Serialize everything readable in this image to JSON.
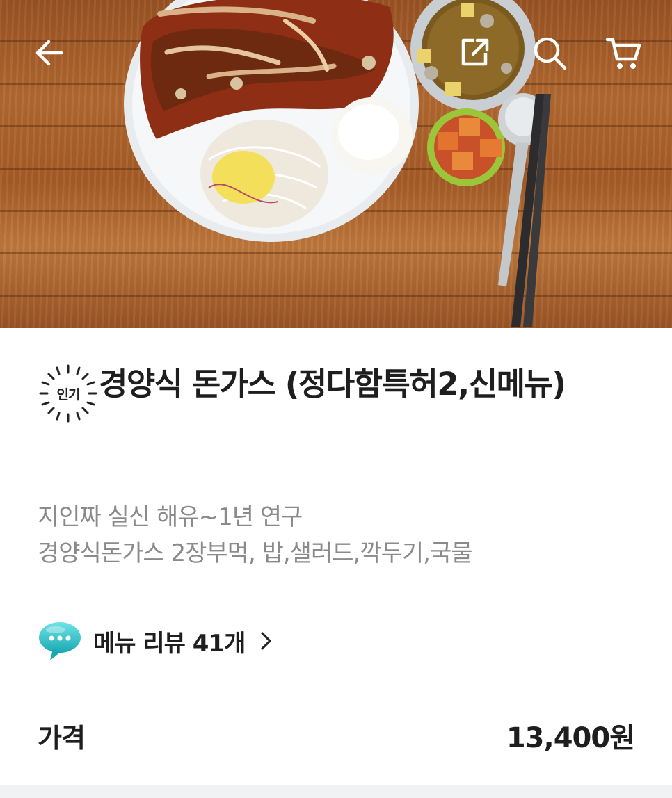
{
  "header": {
    "back_icon": "arrow-left-icon",
    "share_icon": "share-icon",
    "search_icon": "search-icon",
    "cart_icon": "cart-icon",
    "icon_color": "#ffffff"
  },
  "menu": {
    "badge_label": "인기",
    "title": "경양식 돈가스 (정다함특허2,신메뉴)",
    "description_lines": [
      "지인짜 실신 해유~1년 연구",
      "경양식돈가스 2장부먹, 밥,샐러드,깍두기,국물"
    ],
    "review_label": "메뉴 리뷰 41개",
    "review_icon": "speech-bubble-icon",
    "review_icon_color": "#2bc2c8",
    "price_label": "가격",
    "price_value": "13,400원"
  }
}
